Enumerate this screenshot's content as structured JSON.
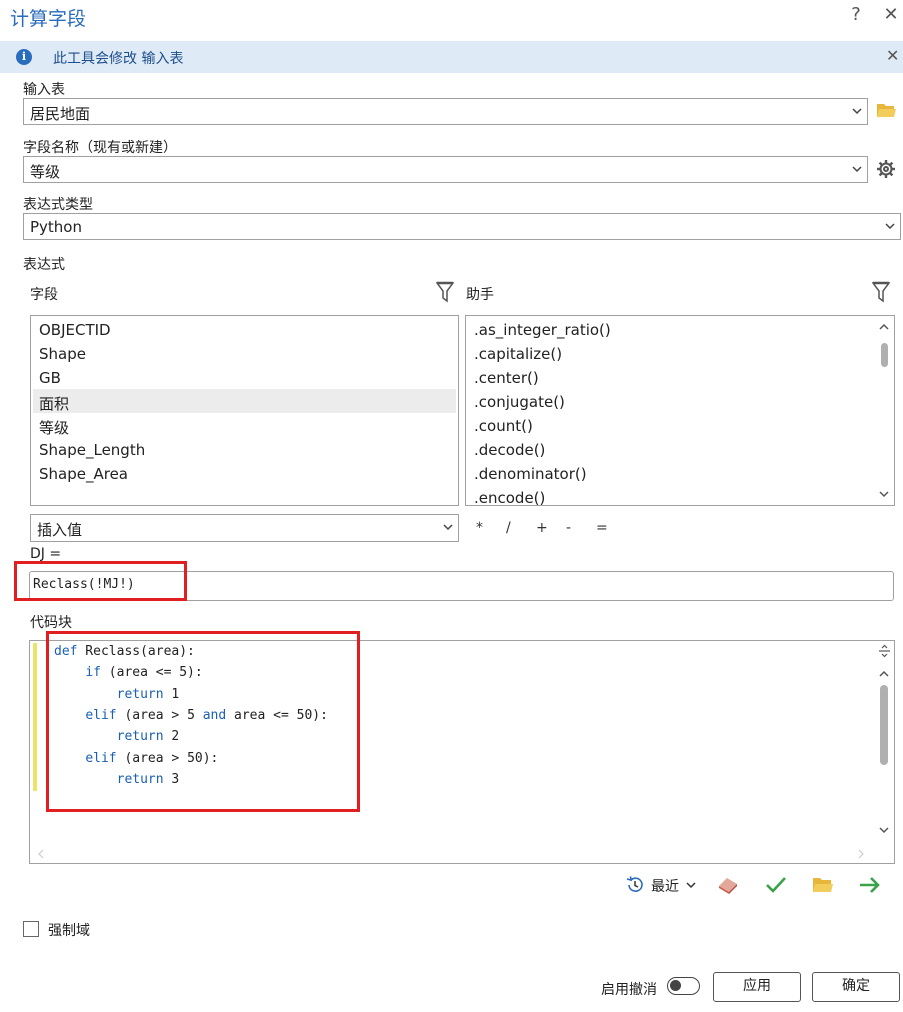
{
  "window": {
    "title": "计算字段",
    "help": "?",
    "close": "✕"
  },
  "info_bar": {
    "icon": "info-icon",
    "text": "此工具会修改 输入表",
    "close": "✕"
  },
  "input_table": {
    "label": "输入表",
    "value": "居民地面"
  },
  "field_name": {
    "label": "字段名称（现有或新建）",
    "value": "等级"
  },
  "expression_type": {
    "label": "表达式类型",
    "value": "Python"
  },
  "expression": {
    "label": "表达式",
    "fields_header": "字段",
    "helpers_header": "助手",
    "fields": [
      "OBJECTID",
      "Shape",
      "GB",
      "面积",
      "等级",
      "Shape_Length",
      "Shape_Area"
    ],
    "selected_field": "面积",
    "helpers": [
      ".as_integer_ratio()",
      ".capitalize()",
      ".center()",
      ".conjugate()",
      ".count()",
      ".decode()",
      ".denominator()",
      ".encode()"
    ],
    "insert_value": "插入值",
    "operators": [
      "*",
      "/",
      "+",
      "-",
      "="
    ],
    "target_label": "DJ =",
    "value": "Reclass(!MJ!)"
  },
  "code_block": {
    "label": "代码块",
    "lines": [
      [
        {
          "t": "def",
          "k": true
        },
        {
          "t": " Reclass(area):"
        }
      ],
      [
        {
          "t": "    "
        },
        {
          "t": "if",
          "k": true
        },
        {
          "t": " (area <= 5):"
        }
      ],
      [
        {
          "t": "        "
        },
        {
          "t": "return",
          "k": true
        },
        {
          "t": " 1"
        }
      ],
      [
        {
          "t": "    "
        },
        {
          "t": "elif",
          "k": true
        },
        {
          "t": " (area > 5 "
        },
        {
          "t": "and",
          "k": true
        },
        {
          "t": " area <= 50):"
        }
      ],
      [
        {
          "t": "        "
        },
        {
          "t": "return",
          "k": true
        },
        {
          "t": " 2"
        }
      ],
      [
        {
          "t": "    "
        },
        {
          "t": "elif",
          "k": true
        },
        {
          "t": " (area > 50):"
        }
      ],
      [
        {
          "t": "        "
        },
        {
          "t": "return",
          "k": true
        },
        {
          "t": " 3"
        }
      ]
    ]
  },
  "toolbar": {
    "recent_label": "最近"
  },
  "enforce_domains": {
    "label": "强制域",
    "checked": false
  },
  "footer": {
    "undo_label": "启用撤消",
    "apply": "应用",
    "ok": "确定"
  },
  "colors": {
    "accent": "#2a6cbe",
    "info_bg": "#deebf7",
    "highlight": "#e02020",
    "keyword": "#1a5fb4"
  }
}
